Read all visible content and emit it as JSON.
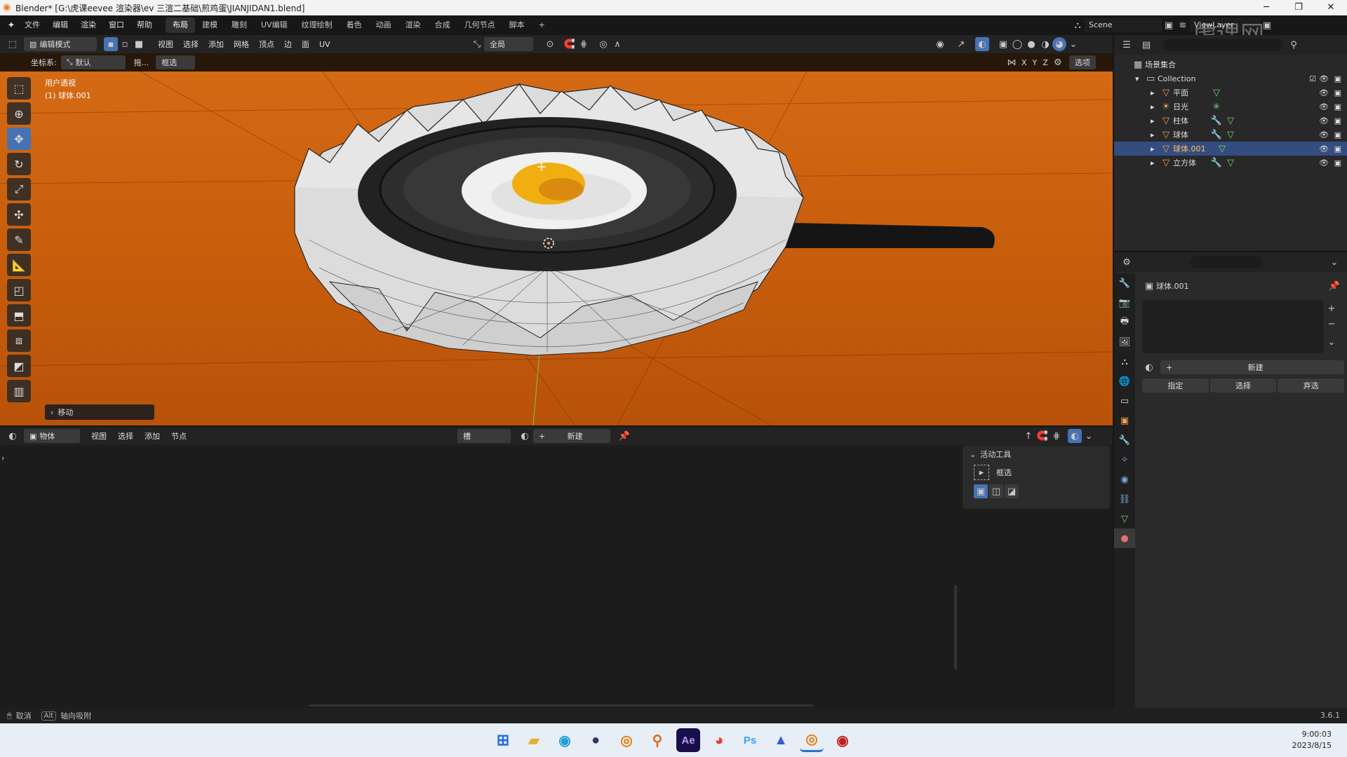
{
  "window": {
    "title": "Blender* [G:\\虎课eevee 渲染器\\ev 三渲二基础\\煎鸡蛋\\JIANJIDAN1.blend]",
    "controls": [
      "─",
      "❐",
      "✕"
    ]
  },
  "menubar": {
    "menus": [
      "文件",
      "编辑",
      "渲染",
      "窗口",
      "帮助"
    ],
    "workspaces": [
      "布局",
      "建模",
      "雕刻",
      "UV编辑",
      "纹理绘制",
      "着色",
      "动画",
      "渲染",
      "合成",
      "几何节点",
      "脚本"
    ],
    "active_workspace": "布局",
    "add_workspace": "+",
    "scene": "Scene",
    "view_layer": "ViewLayer"
  },
  "viewport_header": {
    "mode": "编辑模式",
    "menus": [
      "视图",
      "选择",
      "添加",
      "网格",
      "顶点",
      "边",
      "面",
      "UV"
    ],
    "transform_orientation": "全局",
    "options": "选项",
    "axes": [
      "X",
      "Y",
      "Z"
    ]
  },
  "viewport_subheader": {
    "coord_label": "坐标系:",
    "coord_value": "默认",
    "drag_label": "拖...",
    "select_mode": "框选"
  },
  "viewport": {
    "view_name": "用户透视",
    "object_name": "(1) 球体.001",
    "last_op": "移动"
  },
  "outliner": {
    "scene_collection": "场景集合",
    "collection": "Collection",
    "items": [
      {
        "name": "平面",
        "selected": false
      },
      {
        "name": "日光",
        "selected": false
      },
      {
        "name": "柱体",
        "selected": false
      },
      {
        "name": "球体",
        "selected": false
      },
      {
        "name": "球体.001",
        "selected": true
      },
      {
        "name": "立方体",
        "selected": false
      }
    ]
  },
  "properties": {
    "object_name": "球体.001",
    "new_button": "新建",
    "assign": "指定",
    "select": "选择",
    "deselect": "弃选"
  },
  "node_editor": {
    "editor_type": "物体",
    "menus": [
      "视图",
      "选择",
      "添加",
      "节点"
    ],
    "slot": "槽",
    "new_button": "新建"
  },
  "active_tool_panel": {
    "header": "活动工具",
    "tool": "框选"
  },
  "statusbar": {
    "cancel": "取消",
    "alt_key": "Alt",
    "axis_snap": "轴向吸附",
    "version": "3.6.1"
  },
  "taskbar": {
    "time": "9:00:03",
    "date": "2023/8/15",
    "apps": [
      "windows-start",
      "file-explorer",
      "edge",
      "steam",
      "blender",
      "search",
      "after-effects",
      "chrome",
      "photoshop",
      "affinity",
      "blender-active",
      "davinci"
    ]
  },
  "watermark": "虎课网",
  "colors": {
    "accent": "#4772b3",
    "selection": "#334d80",
    "viewport_bg": "#c85e0c",
    "active_tool": "#4772b3"
  }
}
